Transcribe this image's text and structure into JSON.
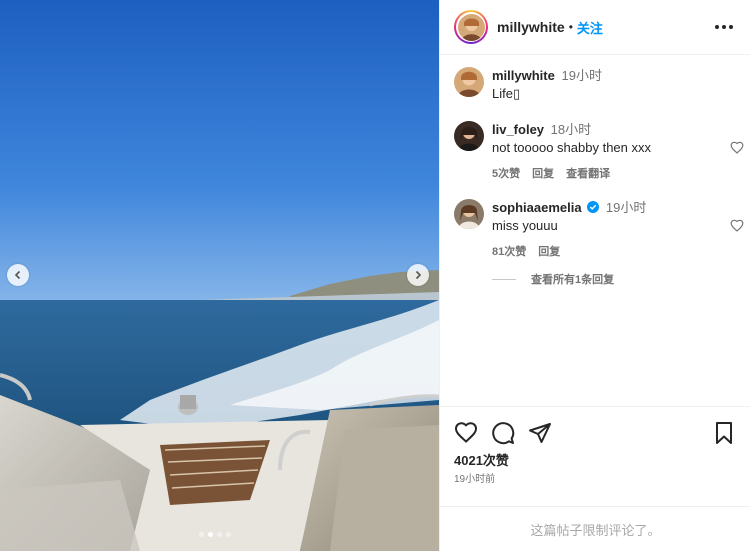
{
  "post": {
    "author": "millywhite",
    "separator": "•",
    "follow_label": "关注",
    "more_icon": "more-horizontal-icon"
  },
  "media": {
    "carousel_dots": 4,
    "active_dot": 1,
    "prev_icon": "chevron-left-icon",
    "next_icon": "chevron-right-icon"
  },
  "caption": {
    "user": "millywhite",
    "time": "19小时",
    "text": "Life▯"
  },
  "comments": [
    {
      "user": "liv_foley",
      "time": "18小时",
      "text": "not tooooo shabby then xxx",
      "likes": "5次赞",
      "reply": "回复",
      "translate": "查看翻译",
      "verified": false
    },
    {
      "user": "sophiaaemelia",
      "time": "19小时",
      "text": "miss youuu",
      "likes": "81次赞",
      "reply": "回复",
      "verified": true
    }
  ],
  "view_replies": "查看所有1条回复",
  "actions": {
    "like_icon": "heart-icon",
    "comment_icon": "comment-icon",
    "share_icon": "send-icon",
    "save_icon": "bookmark-icon",
    "likes_count": "4021次赞",
    "posted_ago": "19小时前"
  },
  "comments_limited": "这篇帖子限制评论了。",
  "colors": {
    "link": "#0095f6",
    "text": "#262626",
    "muted": "#737373"
  }
}
